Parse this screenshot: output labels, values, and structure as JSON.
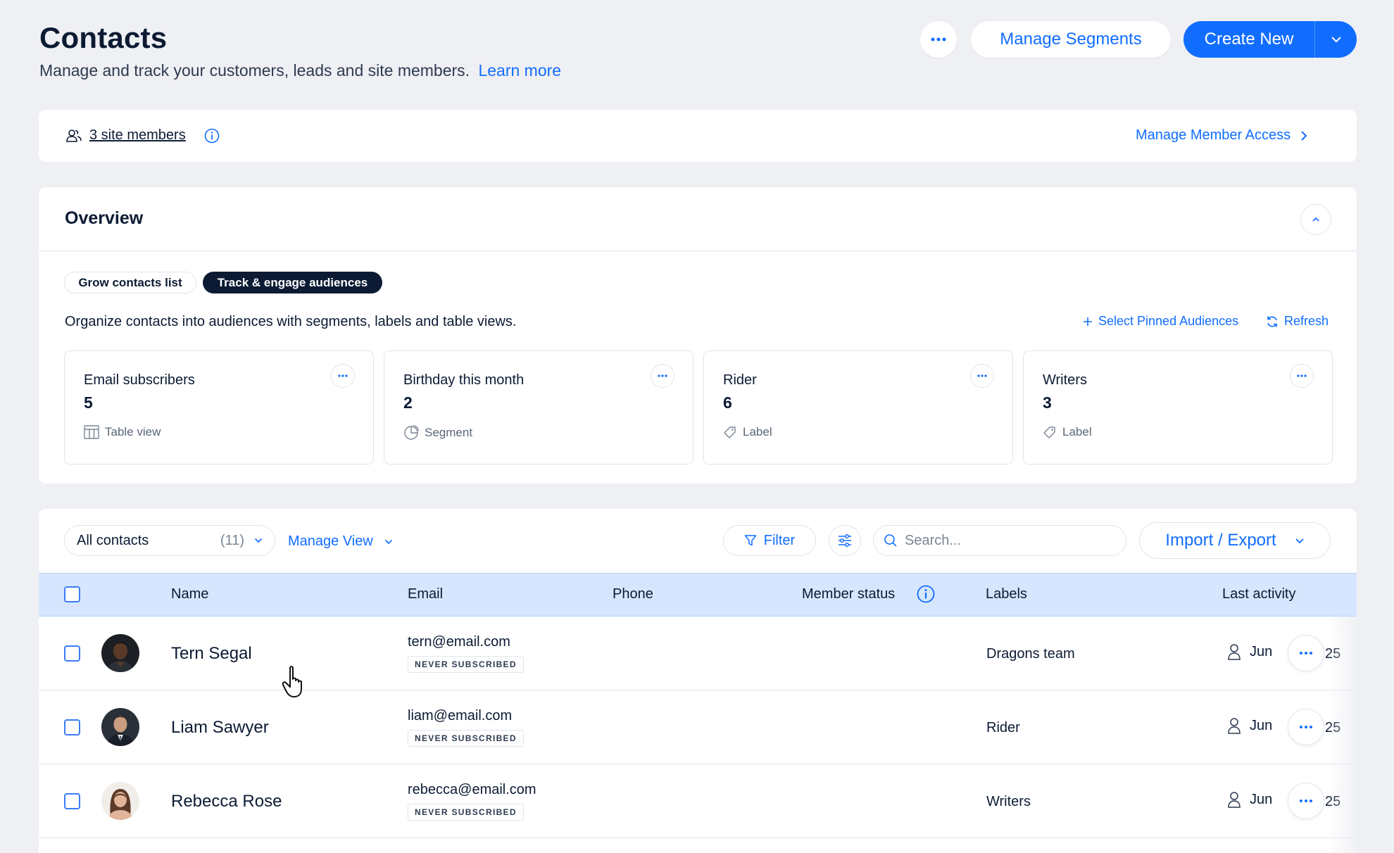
{
  "header": {
    "title": "Contacts",
    "subtitle": "Manage and track your customers, leads and site members.",
    "learn_more": "Learn more",
    "more_label": "More actions",
    "manage_segments": "Manage Segments",
    "create_new": "Create New"
  },
  "members_bar": {
    "link": "3 site members",
    "manage_access": "Manage Member Access"
  },
  "overview": {
    "title": "Overview",
    "chips": [
      "Grow contacts list",
      "Track & engage audiences"
    ],
    "active_chip": "Track & engage audiences",
    "description": "Organize contacts into audiences with segments, labels and table views.",
    "select_pinned": "Select Pinned Audiences",
    "refresh": "Refresh",
    "audiences": [
      {
        "title": "Email subscribers",
        "count": "5",
        "type": "Table view",
        "icon": "table-icon"
      },
      {
        "title": "Birthday this month",
        "count": "2",
        "type": "Segment",
        "icon": "segment-icon"
      },
      {
        "title": "Rider",
        "count": "6",
        "type": "Label",
        "icon": "tag-icon"
      },
      {
        "title": "Writers",
        "count": "3",
        "type": "Label",
        "icon": "tag-icon"
      }
    ]
  },
  "table": {
    "view_select": {
      "label": "All contacts",
      "count": "(11)"
    },
    "manage_view": "Manage View",
    "filter": "Filter",
    "search_placeholder": "Search...",
    "import_export": "Import / Export",
    "columns": [
      "Name",
      "Email",
      "Phone",
      "Member status",
      "Labels",
      "Last activity"
    ],
    "rows": [
      {
        "name": "Tern Segal",
        "email": "tern@email.com",
        "badge": "NEVER SUBSCRIBED",
        "label": "Dragons team",
        "activity_start": "Jun",
        "activity_end": "25"
      },
      {
        "name": "Liam Sawyer",
        "email": "liam@email.com",
        "badge": "NEVER SUBSCRIBED",
        "label": "Rider",
        "activity_start": "Jun",
        "activity_end": "25"
      },
      {
        "name": "Rebecca Rose",
        "email": "rebecca@email.com",
        "badge": "NEVER SUBSCRIBED",
        "label": "Writers",
        "activity_start": "Jun",
        "activity_end": "25"
      }
    ]
  },
  "colors": {
    "accent": "#116dff",
    "background": "#eff0f4",
    "header_row": "#d6e6fe",
    "text": "#0c1b33"
  }
}
